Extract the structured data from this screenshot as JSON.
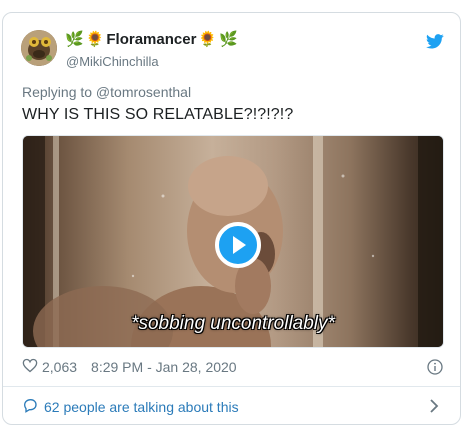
{
  "author": {
    "name_prefix_emojis": [
      "🌿",
      "🌻"
    ],
    "name": "Floramancer",
    "name_suffix_emojis": [
      "🌻",
      "🌿"
    ],
    "handle": "@MikiChinchilla"
  },
  "tweet": {
    "replying_to": "Replying to @tomrosenthal",
    "text": "WHY IS THIS SO RELATABLE?!?!?!?",
    "media_caption": "*sobbing uncontrollably*"
  },
  "meta": {
    "likes": "2,063",
    "timestamp": "8:29 PM - Jan 28, 2020"
  },
  "footer": {
    "talking": "62 people are talking about this"
  },
  "colors": {
    "twitter_blue": "#1da1f2",
    "link_blue": "#2b7bb9",
    "muted_gray": "#697882"
  },
  "icons": [
    "twitter-bird-icon",
    "play-icon",
    "heart-icon",
    "info-icon",
    "comment-bubble-icon",
    "chevron-right-icon"
  ]
}
